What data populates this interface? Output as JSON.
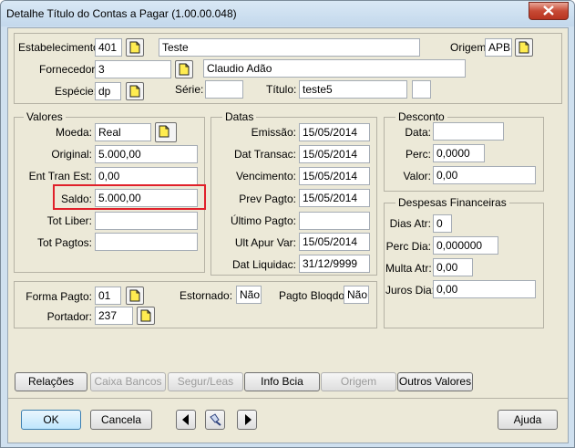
{
  "window": {
    "title": "Detalhe Título do Contas a Pagar (1.00.00.048)"
  },
  "header": {
    "estabelecimento_label": "Estabelecimento:",
    "estabelecimento_code": "401",
    "estabelecimento_name": "Teste",
    "origem_label": "Origem:",
    "origem_value": "APB",
    "fornecedor_label": "Fornecedor:",
    "fornecedor_code": "3",
    "fornecedor_name": "Claudio Adão",
    "especie_label": "Espécie:",
    "especie_value": "dp",
    "serie_label": "Série:",
    "serie_value": "",
    "titulo_label": "Título:",
    "titulo_value": "teste5",
    "parcela_value": ""
  },
  "valores": {
    "title": "Valores",
    "moeda_label": "Moeda:",
    "moeda_value": "Real",
    "original_label": "Original:",
    "original_value": "5.000,00",
    "ent_tran_label": "Ent Tran Est:",
    "ent_tran_value": "0,00",
    "saldo_label": "Saldo:",
    "saldo_value": "5.000,00",
    "tot_liber_label": "Tot Liber:",
    "tot_liber_value": "",
    "tot_pagtos_label": "Tot Pagtos:",
    "tot_pagtos_value": ""
  },
  "datas": {
    "title": "Datas",
    "emissao_label": "Emissão:",
    "emissao_value": "15/05/2014",
    "dat_transac_label": "Dat Transac:",
    "dat_transac_value": "15/05/2014",
    "vencimento_label": "Vencimento:",
    "vencimento_value": "15/05/2014",
    "prev_pagto_label": "Prev Pagto:",
    "prev_pagto_value": "15/05/2014",
    "ultimo_pagto_label": "Último Pagto:",
    "ultimo_pagto_value": "",
    "ult_apur_label": "Ult Apur Var:",
    "ult_apur_value": "15/05/2014",
    "dat_liquidac_label": "Dat Liquidac:",
    "dat_liquidac_value": "31/12/9999"
  },
  "desconto": {
    "title": "Desconto",
    "data_label": "Data:",
    "data_value": "",
    "perc_label": "Perc:",
    "perc_value": "0,0000",
    "valor_label": "Valor:",
    "valor_value": "0,00"
  },
  "despesas": {
    "title": "Despesas Financeiras",
    "dias_atr_label": "Dias Atr:",
    "dias_atr_value": "0",
    "perc_dia_label": "Perc Dia:",
    "perc_dia_value": "0,000000",
    "multa_atr_label": "Multa Atr:",
    "multa_atr_value": "0,00",
    "juros_dia_label": "Juros Dia:",
    "juros_dia_value": "0,00"
  },
  "pagamento": {
    "forma_pagto_label": "Forma Pagto:",
    "forma_pagto_value": "01",
    "estornado_label": "Estornado:",
    "estornado_value": "Não",
    "pagto_bloqdo_label": "Pagto Bloqdo:",
    "pagto_bloqdo_value": "Não",
    "portador_label": "Portador:",
    "portador_value": "237"
  },
  "action_buttons": {
    "relacoes": "Relações",
    "caixa_bancos": "Caixa Bancos",
    "segur_leas": "Segur/Leas",
    "info_bcia": "Info Bcia",
    "origem": "Origem",
    "outros_valores": "Outros Valores"
  },
  "footer": {
    "ok": "OK",
    "cancela": "Cancela",
    "ajuda": "Ajuda"
  },
  "colors": {
    "highlight": "#e0202a",
    "window_frame": "#cfe0ef",
    "panel": "#ece9d8"
  },
  "icons": {
    "lookup": "zoom-lookup-icon",
    "prev": "arrow-left-icon",
    "next": "arrow-right-icon",
    "go": "flashlight-icon"
  }
}
